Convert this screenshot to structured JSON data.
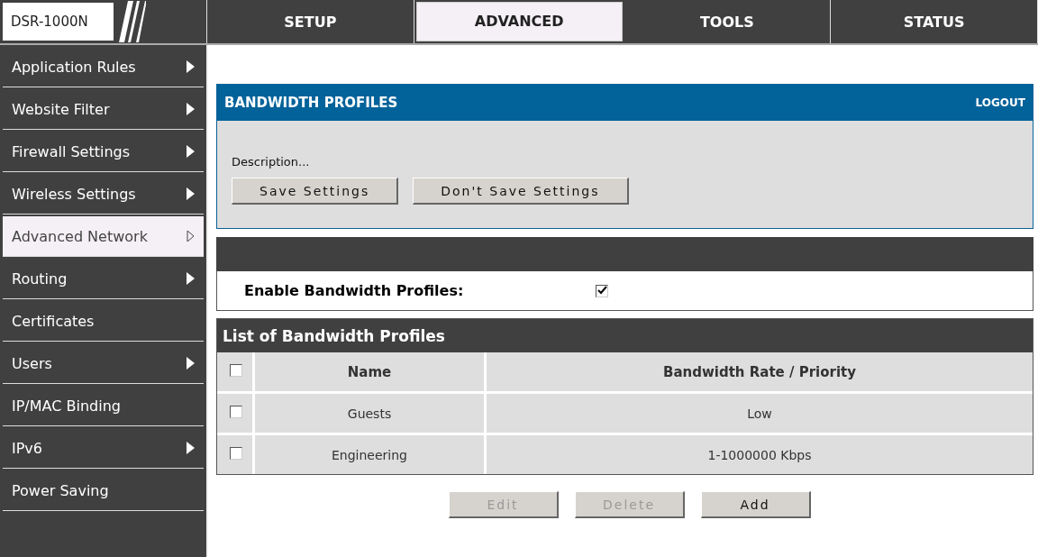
{
  "logo": "DSR-1000N",
  "tabs": [
    {
      "label": "SETUP",
      "selected": false
    },
    {
      "label": "ADVANCED",
      "selected": true
    },
    {
      "label": "TOOLS",
      "selected": false
    },
    {
      "label": "STATUS",
      "selected": false
    }
  ],
  "sidebar": {
    "items": [
      {
        "label": "Application Rules",
        "has_submenu": true,
        "selected": false
      },
      {
        "label": "Website Filter",
        "has_submenu": true,
        "selected": false
      },
      {
        "label": "Firewall Settings",
        "has_submenu": true,
        "selected": false
      },
      {
        "label": "Wireless Settings",
        "has_submenu": true,
        "selected": false
      },
      {
        "label": "Advanced Network",
        "has_submenu": true,
        "selected": true
      },
      {
        "label": "Routing",
        "has_submenu": true,
        "selected": false
      },
      {
        "label": "Certificates",
        "has_submenu": false,
        "selected": false
      },
      {
        "label": "Users",
        "has_submenu": true,
        "selected": false
      },
      {
        "label": "IP/MAC Binding",
        "has_submenu": false,
        "selected": false
      },
      {
        "label": "IPv6",
        "has_submenu": true,
        "selected": false
      },
      {
        "label": "Power Saving",
        "has_submenu": false,
        "selected": false
      }
    ]
  },
  "panel": {
    "title": "BANDWIDTH PROFILES",
    "logout": "LOGOUT",
    "description": "Description...",
    "buttons": [
      {
        "label": "Save Settings",
        "disabled": false
      },
      {
        "label": "Don't Save Settings",
        "disabled": false
      }
    ]
  },
  "enable": {
    "label": "Enable Bandwidth Profiles:",
    "checked": true
  },
  "table": {
    "title": "List of Bandwidth Profiles",
    "header_checked": false,
    "columns": [
      "Name",
      "Bandwidth Rate / Priority"
    ],
    "rows": [
      {
        "checked": false,
        "cells": [
          "Guests",
          "Low"
        ]
      },
      {
        "checked": false,
        "cells": [
          "Engineering",
          "1-1000000 Kbps"
        ]
      }
    ]
  },
  "actions": [
    {
      "label": "Edit",
      "disabled": true
    },
    {
      "label": "Delete",
      "disabled": true
    },
    {
      "label": "Add",
      "disabled": false
    }
  ]
}
